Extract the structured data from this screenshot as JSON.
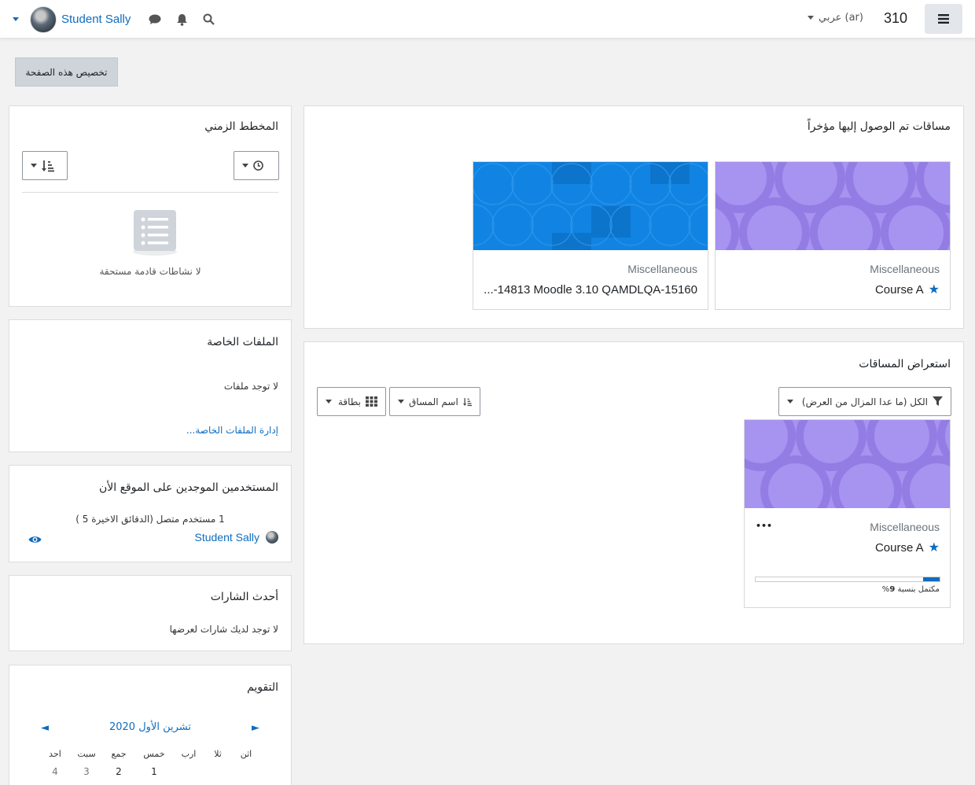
{
  "navbar": {
    "user_name": "Student Sally",
    "language": "عربي (ar)",
    "counter": "310"
  },
  "page": {
    "customise_label": "تخصيص هذه الصفحة"
  },
  "recent": {
    "title": "مساقات تم الوصول إليها مؤخراً",
    "courses": [
      {
        "category": "Miscellaneous",
        "name": "Course A",
        "starred": true
      },
      {
        "category": "Miscellaneous",
        "name": "...-14813 Moodle 3.10 QAMDLQA-15160",
        "starred": false
      }
    ]
  },
  "overview": {
    "title": "استعراض المساقات",
    "filter_label": "الكل (ما عدا المزال من العرض)",
    "sort_label": "اسم المساق",
    "view_label": "بطاقة",
    "course": {
      "category": "Miscellaneous",
      "name": "Course A",
      "more": "•••",
      "progress_percent": 9,
      "progress_text_prefix": "مكتمل بنسبة",
      "progress_value": "9",
      "progress_suffix": "%"
    }
  },
  "timeline": {
    "title": "المخطط الزمني",
    "empty": "لا نشاطات قادمة مستحقة"
  },
  "files": {
    "title": "الملفات الخاصة",
    "empty": "لا توجد ملفات",
    "manage": "إدارة الملفات الخاصة..."
  },
  "online": {
    "title": "المستخدمين الموجدين على الموقع الأن",
    "summary": "1 مستخدم متصل (الدقائق الاخيرة 5 )",
    "user": "Student Sally"
  },
  "badges": {
    "title": "أحدث الشارات",
    "empty": "لا توجد لديك شارات لعرضها"
  },
  "calendar": {
    "title": "التقويم",
    "month": "تشرين الأول 2020",
    "prev": "◄",
    "next": "►",
    "days": [
      "اثن",
      "ثلا",
      "ارب",
      "خمس",
      "جمع",
      "سبت",
      "احد"
    ],
    "dates": [
      "1",
      "2",
      "3",
      "4"
    ]
  },
  "colors": {
    "accent": "#0f6cbf",
    "course_a_bg": "#a58cf0",
    "course_b_bg": "#0f83e0"
  }
}
